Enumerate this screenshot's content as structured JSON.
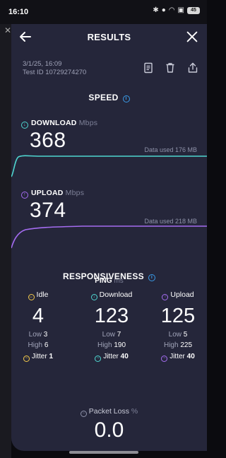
{
  "status": {
    "time": "16:10",
    "battery": "45"
  },
  "header": {
    "title": "RESULTS"
  },
  "meta": {
    "date": "3/1/25, 16:09",
    "test_id": "Test ID 10729274270"
  },
  "speed": {
    "title": "SPEED",
    "download": {
      "label": "DOWNLOAD",
      "unit": "Mbps",
      "value": "368",
      "data_used": "Data used 176 MB",
      "color": "#4fd6d0"
    },
    "upload": {
      "label": "UPLOAD",
      "unit": "Mbps",
      "value": "374",
      "data_used": "Data used 218 MB",
      "color": "#a46cf0"
    }
  },
  "responsiveness": {
    "title": "RESPONSIVENESS",
    "ping_label": "PING",
    "ping_unit": "ms",
    "idle": {
      "label": "Idle",
      "value": "4",
      "low_label": "Low",
      "low": "3",
      "high_label": "High",
      "high": "6",
      "jitter_label": "Jitter",
      "jitter": "1",
      "color": "#f2c94c"
    },
    "download": {
      "label": "Download",
      "value": "123",
      "low_label": "Low",
      "low": "7",
      "high_label": "High",
      "high": "190",
      "jitter_label": "Jitter",
      "jitter": "40",
      "color": "#4fd6d0"
    },
    "upload": {
      "label": "Upload",
      "value": "125",
      "low_label": "Low",
      "low": "5",
      "high_label": "High",
      "high": "225",
      "jitter_label": "Jitter",
      "jitter": "40",
      "color": "#a46cf0"
    }
  },
  "packet_loss": {
    "label": "Packet Loss",
    "unit": "%",
    "value": "0.0"
  },
  "icons": [
    "back-arrow-icon",
    "close-icon",
    "notes-icon",
    "trash-icon",
    "share-icon",
    "info-icon"
  ]
}
